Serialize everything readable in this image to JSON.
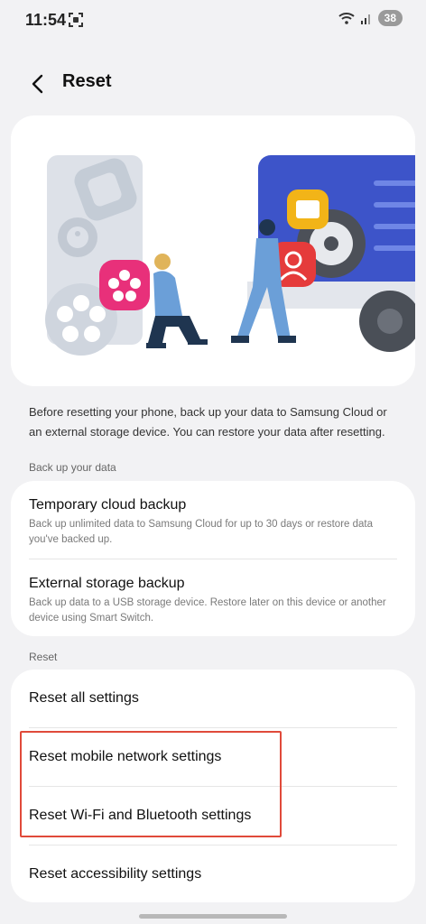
{
  "status": {
    "time": "11:54",
    "battery": "38"
  },
  "header": {
    "title": "Reset"
  },
  "intro": "Before resetting your phone, back up your data to Samsung Cloud or an external storage device. You can restore your data after resetting.",
  "backup_section": {
    "label": "Back up your data",
    "items": [
      {
        "title": "Temporary cloud backup",
        "subtitle": "Back up unlimited data to Samsung Cloud for up to 30 days or restore data you've backed up."
      },
      {
        "title": "External storage backup",
        "subtitle": "Back up data to a USB storage device. Restore later on this device or another device using Smart Switch."
      }
    ]
  },
  "reset_section": {
    "label": "Reset",
    "items": [
      {
        "title": "Reset all settings"
      },
      {
        "title": "Reset mobile network settings"
      },
      {
        "title": "Reset Wi-Fi and Bluetooth settings"
      },
      {
        "title": "Reset accessibility settings"
      }
    ]
  },
  "colors": {
    "highlight": "#e04a3a",
    "truck": "#3d54c9",
    "figure": "#6b9fd8"
  }
}
